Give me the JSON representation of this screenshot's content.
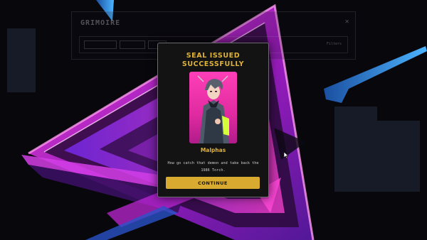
{
  "background_panel": {
    "title": "GRIMOIRE",
    "close_glyph": "✕",
    "corner_text": "Filters"
  },
  "modal": {
    "title": "SEAL ISSUED SUCCESSFULLY",
    "character_name": "Malphas",
    "description": "How go catch that demon and take back the 1986 Torch.",
    "continue_label": "CONTINUE",
    "portrait_icon": "demon-character-portrait"
  },
  "colors": {
    "accent_gold": "#e0b23a",
    "button_gold": "#d8aa30",
    "neon_magenta": "#c020d8",
    "neon_blue": "#2f7fd8"
  }
}
